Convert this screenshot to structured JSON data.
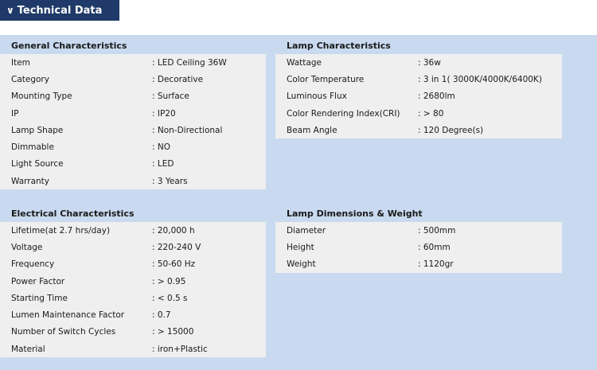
{
  "header": {
    "tab_label": "Technical Data",
    "chevron_glyph": "∨"
  },
  "general": {
    "title": "General Characteristics",
    "rows": [
      {
        "k": "Item",
        "v": ": LED Ceiling 36W"
      },
      {
        "k": "Category",
        "v": ": Decorative"
      },
      {
        "k": "Mounting Type",
        "v": ": Surface"
      },
      {
        "k": "IP",
        "v": ": IP20"
      },
      {
        "k": "Lamp Shape",
        "v": ": Non-Directional"
      },
      {
        "k": "Dimmable",
        "v": ": NO"
      },
      {
        "k": "Light Source",
        "v": ": LED"
      },
      {
        "k": "Warranty",
        "v": ": 3 Years"
      }
    ]
  },
  "lamp": {
    "title": "Lamp Characteristics",
    "rows": [
      {
        "k": "Wattage",
        "v": ": 36w"
      },
      {
        "k": "Color Temperature",
        "v": ": 3 in 1( 3000K/4000K/6400K)"
      },
      {
        "k": "Luminous Flux",
        "v": ": 2680lm"
      },
      {
        "k": "Color Rendering Index(CRI)",
        "v": ": > 80"
      },
      {
        "k": "Beam Angle",
        "v": ": 120 Degree(s)"
      }
    ]
  },
  "electrical": {
    "title": "Electrical Characteristics",
    "rows": [
      {
        "k": "Lifetime(at 2.7 hrs/day)",
        "v": ": 20,000 h"
      },
      {
        "k": "Voltage",
        "v": ": 220-240 V"
      },
      {
        "k": "Frequency",
        "v": ": 50-60 Hz"
      },
      {
        "k": "Power Factor",
        "v": ": > 0.95"
      },
      {
        "k": "Starting Time",
        "v": ": < 0.5 s"
      },
      {
        "k": "Lumen Maintenance Factor",
        "v": ": 0.7"
      },
      {
        "k": "Number of Switch Cycles",
        "v": ": > 15000"
      },
      {
        "k": "Material",
        "v": ": iron+Plastic"
      }
    ]
  },
  "dimensions": {
    "title": "Lamp Dimensions & Weight",
    "rows": [
      {
        "k": "Diameter",
        "v": ": 500mm"
      },
      {
        "k": "Height",
        "v": ": 60mm"
      },
      {
        "k": "Weight",
        "v": ": 1120gr"
      }
    ]
  },
  "colors": {
    "header_tab": "#1f3a68",
    "content_bg": "#c9daf0",
    "table_bg": "#efefef"
  }
}
